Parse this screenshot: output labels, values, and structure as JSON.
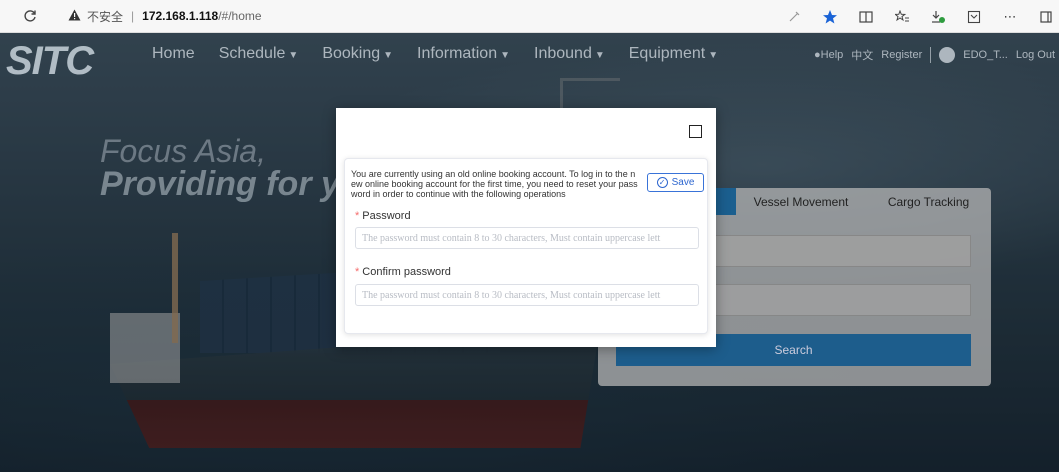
{
  "browser": {
    "insecure_label": "不安全",
    "host": "172.168.1.118",
    "path": "/#/home"
  },
  "nav": {
    "logo": "SITC",
    "menu": [
      {
        "label": "Home",
        "dropdown": false
      },
      {
        "label": "Schedule",
        "dropdown": true
      },
      {
        "label": "Booking",
        "dropdown": true
      },
      {
        "label": "Information",
        "dropdown": true
      },
      {
        "label": "Inbound",
        "dropdown": true
      },
      {
        "label": "Equipment",
        "dropdown": true
      }
    ],
    "help": "Help",
    "language": "中文",
    "register": "Register",
    "user": "EDO_T...",
    "logout": "Log Out"
  },
  "hero": {
    "tagline_line1": "Focus Asia,",
    "tagline_line2": "Providing for y"
  },
  "search_card": {
    "tabs": [
      "",
      "Vessel Movement",
      "Cargo Tracking"
    ],
    "search_label": "Search"
  },
  "modal": {
    "notice": "You are currently using an old online booking account. To log in to the n ew online booking account for the first time, you need to reset your pass word in order to continue with the following operations",
    "save_label": "Save",
    "password_label": "Password",
    "password_placeholder": "The password must contain 8 to 30 characters, Must contain uppercase lett",
    "confirm_label": "Confirm password",
    "confirm_placeholder": "The password must contain 8 to 30 characters, Must contain uppercase lett"
  },
  "colors": {
    "accent": "#1b5f8f",
    "save_blue": "#2d66cf",
    "required": "#f56c6c"
  }
}
